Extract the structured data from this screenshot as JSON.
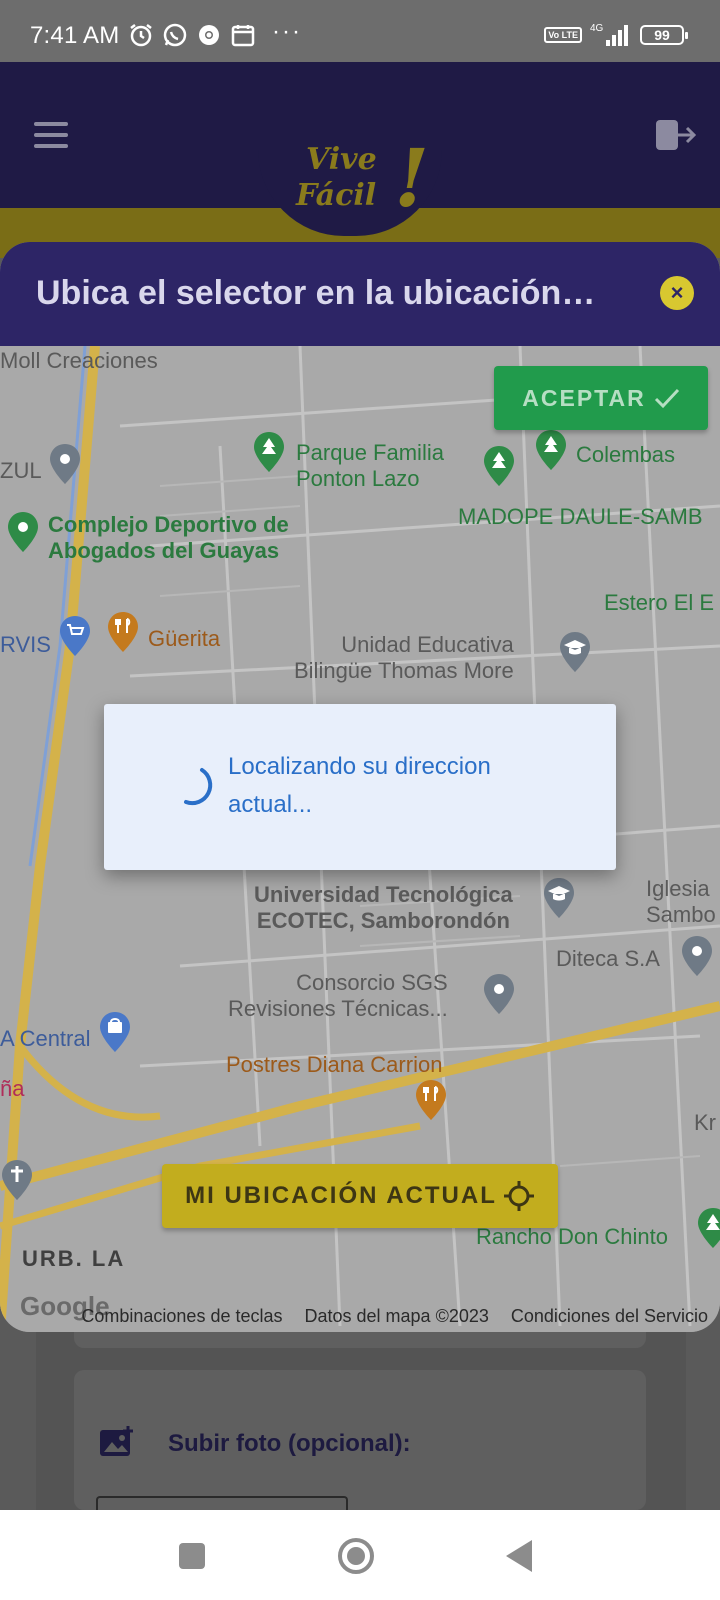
{
  "status_bar": {
    "time": "7:41 AM",
    "dots": "···",
    "network": "4G",
    "volte": "Vo LTE",
    "battery": "99"
  },
  "app_header": {
    "logo_line1": "Vive",
    "logo_line2": "Fácil",
    "logo_mark": "!"
  },
  "sheet": {
    "title": "Ubica el selector en la ubicación que deseas",
    "close_icon": "×",
    "accept_label": "ACEPTAR",
    "my_location_label": "MI UBICACIÓN ACTUAL"
  },
  "map": {
    "pois": [
      {
        "text": "Moll Creaciones"
      },
      {
        "text": "Parque Familia\nPonton Lazo"
      },
      {
        "text": "Colembas"
      },
      {
        "text": "MADOPE DAULE-SAMB"
      },
      {
        "text": "ZUL"
      },
      {
        "text": "Complejo Deportivo de\nAbogados del Guayas"
      },
      {
        "text": "Estero El E"
      },
      {
        "text": "RVIS"
      },
      {
        "text": "Güerita"
      },
      {
        "text": "Unidad Educativa\nBilingüe Thomas More"
      },
      {
        "text": "Universidad Tecnológica\nECOTEC, Samborondón"
      },
      {
        "text": "Iglesia\nSambo"
      },
      {
        "text": "Diteca S.A"
      },
      {
        "text": "Consorcio SGS\nRevisiones Técnicas..."
      },
      {
        "text": "A Central"
      },
      {
        "text": "ña"
      },
      {
        "text": "Postres Diana Carrion"
      },
      {
        "text": "Kr"
      },
      {
        "text": "Rancho Don Chinto"
      },
      {
        "text": "URB. LA"
      }
    ],
    "google_logo": "Google",
    "footer": {
      "shortcuts": "Combinaciones de teclas",
      "map_data": "Datos del mapa ©2023",
      "terms": "Condiciones del Servicio"
    }
  },
  "loading": {
    "text": "Localizando su direccion actual..."
  },
  "form": {
    "upload_label": "Subir foto (opcional):"
  }
}
